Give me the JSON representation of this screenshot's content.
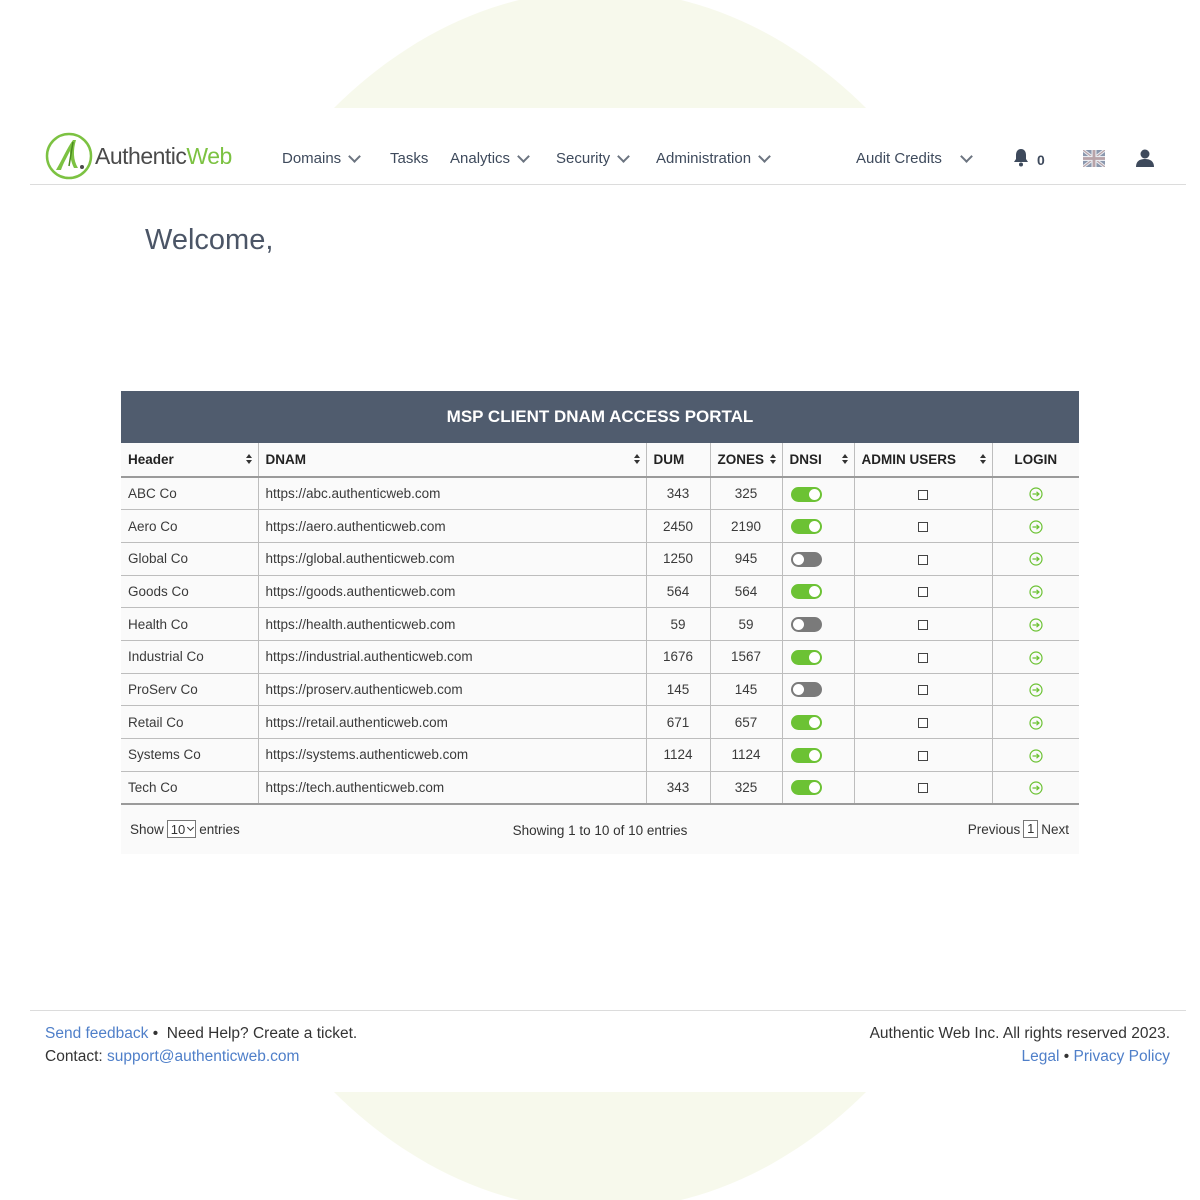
{
  "brand": {
    "name_part1": "Authentic",
    "name_part2": "Web",
    "accent": "#7cc242"
  },
  "nav": {
    "items": [
      {
        "label": "Domains",
        "dropdown": true
      },
      {
        "label": "Tasks",
        "dropdown": false
      },
      {
        "label": "Analytics",
        "dropdown": true
      },
      {
        "label": "Security",
        "dropdown": true
      },
      {
        "label": "Administration",
        "dropdown": true
      }
    ],
    "audit_credits": "Audit Credits",
    "notification_count": "0",
    "icons": {
      "notifications": "bell-icon",
      "language": "uk-flag-icon",
      "account": "user-icon"
    }
  },
  "welcome": "Welcome,",
  "portal": {
    "title": "MSP CLIENT DNAM ACCESS PORTAL",
    "header_color": "#505c6e",
    "columns": [
      "Header",
      "DNAM",
      "DUM",
      "ZONES",
      "DNSI",
      "ADMIN USERS",
      "LOGIN"
    ],
    "rows": [
      {
        "name": "ABC Co",
        "url": "https://abc.authenticweb.com",
        "dum": "343",
        "zones": "325",
        "dnsi": true,
        "admin": false
      },
      {
        "name": "Aero Co",
        "url": "https://aero.authenticweb.com",
        "dum": "2450",
        "zones": "2190",
        "dnsi": true,
        "admin": false
      },
      {
        "name": "Global Co",
        "url": "https://global.authenticweb.com",
        "dum": "1250",
        "zones": "945",
        "dnsi": false,
        "admin": false
      },
      {
        "name": "Goods Co",
        "url": "https://goods.authenticweb.com",
        "dum": "564",
        "zones": "564",
        "dnsi": true,
        "admin": false
      },
      {
        "name": "Health Co",
        "url": "https://health.authenticweb.com",
        "dum": "59",
        "zones": "59",
        "dnsi": false,
        "admin": false
      },
      {
        "name": "Industrial Co",
        "url": "https://industrial.authenticweb.com",
        "dum": "1676",
        "zones": "1567",
        "dnsi": true,
        "admin": false
      },
      {
        "name": "ProServ Co",
        "url": "https://proserv.authenticweb.com",
        "dum": "145",
        "zones": "145",
        "dnsi": false,
        "admin": false
      },
      {
        "name": "Retail Co",
        "url": "https://retail.authenticweb.com",
        "dum": "671",
        "zones": "657",
        "dnsi": true,
        "admin": false
      },
      {
        "name": "Systems Co",
        "url": "https://systems.authenticweb.com",
        "dum": "1124",
        "zones": "1124",
        "dnsi": true,
        "admin": false
      },
      {
        "name": "Tech Co",
        "url": "https://tech.authenticweb.com",
        "dum": "343",
        "zones": "325",
        "dnsi": true,
        "admin": false
      }
    ],
    "show_label": "Show",
    "page_size": "10",
    "entries_label": "entries",
    "showing_text": "Showing 1 to 10 of 10 entries",
    "previous": "Previous",
    "current_page": "1",
    "next": "Next",
    "toggle_on_color": "#6cc234",
    "login_icon_color": "#6cc234"
  },
  "footer": {
    "feedback": "Send feedback",
    "bullet": "•",
    "help": "Need Help? Create a ticket.",
    "contact_label": "Contact:",
    "contact_email": "support@authenticweb.com",
    "copyright": "Authentic Web Inc. All rights reserved 2023.",
    "legal": "Legal",
    "privacy": "Privacy Policy",
    "link_color": "#4f7fc9"
  }
}
